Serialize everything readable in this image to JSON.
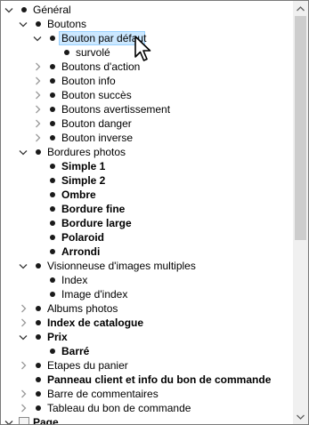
{
  "tree": {
    "rows": [
      {
        "label": "Général",
        "expander": "open",
        "indent": 0,
        "bold": false
      },
      {
        "label": "Boutons",
        "expander": "open",
        "indent": 1,
        "bold": false
      },
      {
        "label": "Bouton par défaut",
        "expander": "open",
        "indent": 2,
        "bold": false,
        "selected": true
      },
      {
        "label": "survolé",
        "expander": "none",
        "indent": 3,
        "bold": false
      },
      {
        "label": "Boutons d'action",
        "expander": "closed",
        "indent": 2,
        "bold": false
      },
      {
        "label": "Bouton info",
        "expander": "closed",
        "indent": 2,
        "bold": false
      },
      {
        "label": "Bouton succès",
        "expander": "closed",
        "indent": 2,
        "bold": false
      },
      {
        "label": "Boutons avertissement",
        "expander": "closed",
        "indent": 2,
        "bold": false
      },
      {
        "label": "Bouton danger",
        "expander": "closed",
        "indent": 2,
        "bold": false
      },
      {
        "label": "Bouton inverse",
        "expander": "closed",
        "indent": 2,
        "bold": false
      },
      {
        "label": "Bordures photos",
        "expander": "open",
        "indent": 1,
        "bold": false
      },
      {
        "label": "Simple 1",
        "expander": "none",
        "indent": 2,
        "bold": true
      },
      {
        "label": "Simple 2",
        "expander": "none",
        "indent": 2,
        "bold": true
      },
      {
        "label": "Ombre",
        "expander": "none",
        "indent": 2,
        "bold": true
      },
      {
        "label": "Bordure fine",
        "expander": "none",
        "indent": 2,
        "bold": true
      },
      {
        "label": "Bordure large",
        "expander": "none",
        "indent": 2,
        "bold": true
      },
      {
        "label": "Polaroid",
        "expander": "none",
        "indent": 2,
        "bold": true
      },
      {
        "label": "Arrondi",
        "expander": "none",
        "indent": 2,
        "bold": true
      },
      {
        "label": "Visionneuse d'images multiples",
        "expander": "open",
        "indent": 1,
        "bold": false
      },
      {
        "label": "Index",
        "expander": "none",
        "indent": 2,
        "bold": false
      },
      {
        "label": "Image d'index",
        "expander": "none",
        "indent": 2,
        "bold": false
      },
      {
        "label": "Albums photos",
        "expander": "closed",
        "indent": 1,
        "bold": false
      },
      {
        "label": "Index de catalogue",
        "expander": "closed",
        "indent": 1,
        "bold": true
      },
      {
        "label": "Prix",
        "expander": "open",
        "indent": 1,
        "bold": true
      },
      {
        "label": "Barré",
        "expander": "none",
        "indent": 2,
        "bold": true
      },
      {
        "label": "Etapes du panier",
        "expander": "closed",
        "indent": 1,
        "bold": false
      },
      {
        "label": "Panneau client et info du bon de commande",
        "expander": "none",
        "indent": 1,
        "bold": true
      },
      {
        "label": "Barre de commentaires",
        "expander": "closed",
        "indent": 1,
        "bold": false
      },
      {
        "label": "Tableau du bon de commande",
        "expander": "closed",
        "indent": 1,
        "bold": false
      },
      {
        "label": "Page",
        "expander": "open",
        "indent": 0,
        "bold": true,
        "icon": "page"
      }
    ]
  },
  "colors": {
    "selection_bg": "#cce8ff",
    "selection_border": "#99d1ff",
    "scrollbar_track": "#f0f0f0",
    "scrollbar_thumb": "#cdcdcd"
  },
  "icons": {
    "expanded": "chevron-down-icon",
    "collapsed": "chevron-right-icon",
    "node": "bullet-icon",
    "cursor": "mouse-pointer-icon"
  }
}
